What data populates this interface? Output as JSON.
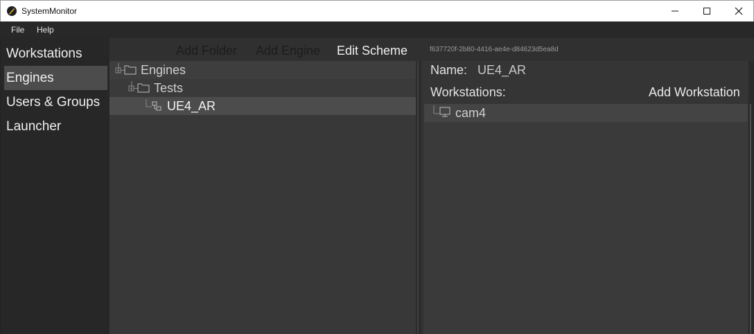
{
  "window": {
    "title": "SystemMonitor"
  },
  "menu": [
    "File",
    "Help"
  ],
  "sidebar": {
    "items": [
      {
        "label": "Workstations"
      },
      {
        "label": "Engines"
      },
      {
        "label": "Users & Groups"
      },
      {
        "label": "Launcher"
      }
    ],
    "active_index": 1
  },
  "toolbar": {
    "add_folder": "Add Folder",
    "add_engine": "Add Engine",
    "edit_scheme": "Edit Scheme"
  },
  "uuid": "f637720f-2b80-4416-ae4e-d84623d5ea8d",
  "tree": [
    {
      "label": "Engines",
      "type": "folder",
      "level": 0
    },
    {
      "label": "Tests",
      "type": "folder",
      "level": 1
    },
    {
      "label": "UE4_AR",
      "type": "engine",
      "level": 2,
      "selected": true
    }
  ],
  "detail": {
    "name_label": "Name:",
    "name_value": "UE4_AR",
    "workstations_label": "Workstations:",
    "add_workstation": "Add Workstation",
    "workstations": [
      {
        "label": "cam4"
      }
    ]
  },
  "colors": {
    "disabled_text": "#1c1c1c",
    "accent_text": "#f0f0f0",
    "selected_bg": "#4c4c4c"
  }
}
